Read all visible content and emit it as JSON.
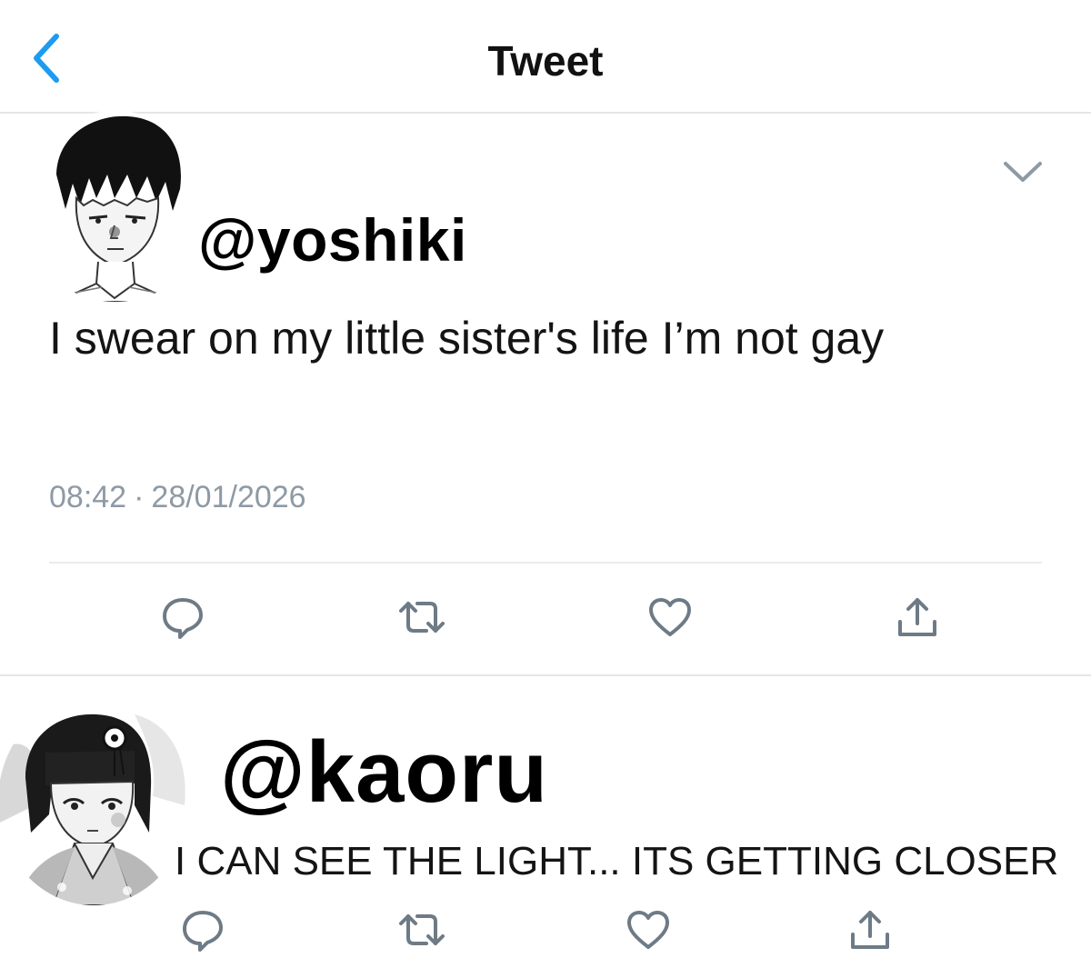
{
  "header": {
    "title": "Tweet"
  },
  "tweet_1": {
    "handle": "@yoshiki",
    "text": "I swear on my little sister's life I’m not gay",
    "time": "08:42",
    "date": "28/01/2026",
    "avatar_icon": "manga-boy-avatar"
  },
  "tweet_2": {
    "handle": "@kaoru",
    "text": "I CAN SEE THE LIGHT... ITS GETTING CLOSER",
    "avatar_icon": "manga-girl-avatar"
  },
  "actions": [
    "reply-icon",
    "retweet-icon",
    "like-icon",
    "share-icon"
  ],
  "colors": {
    "accent": "#1d9bf0",
    "icon_gray": "#6e7b86",
    "divider": "#e3e6e9",
    "timestamp": "#8e9aa5"
  }
}
